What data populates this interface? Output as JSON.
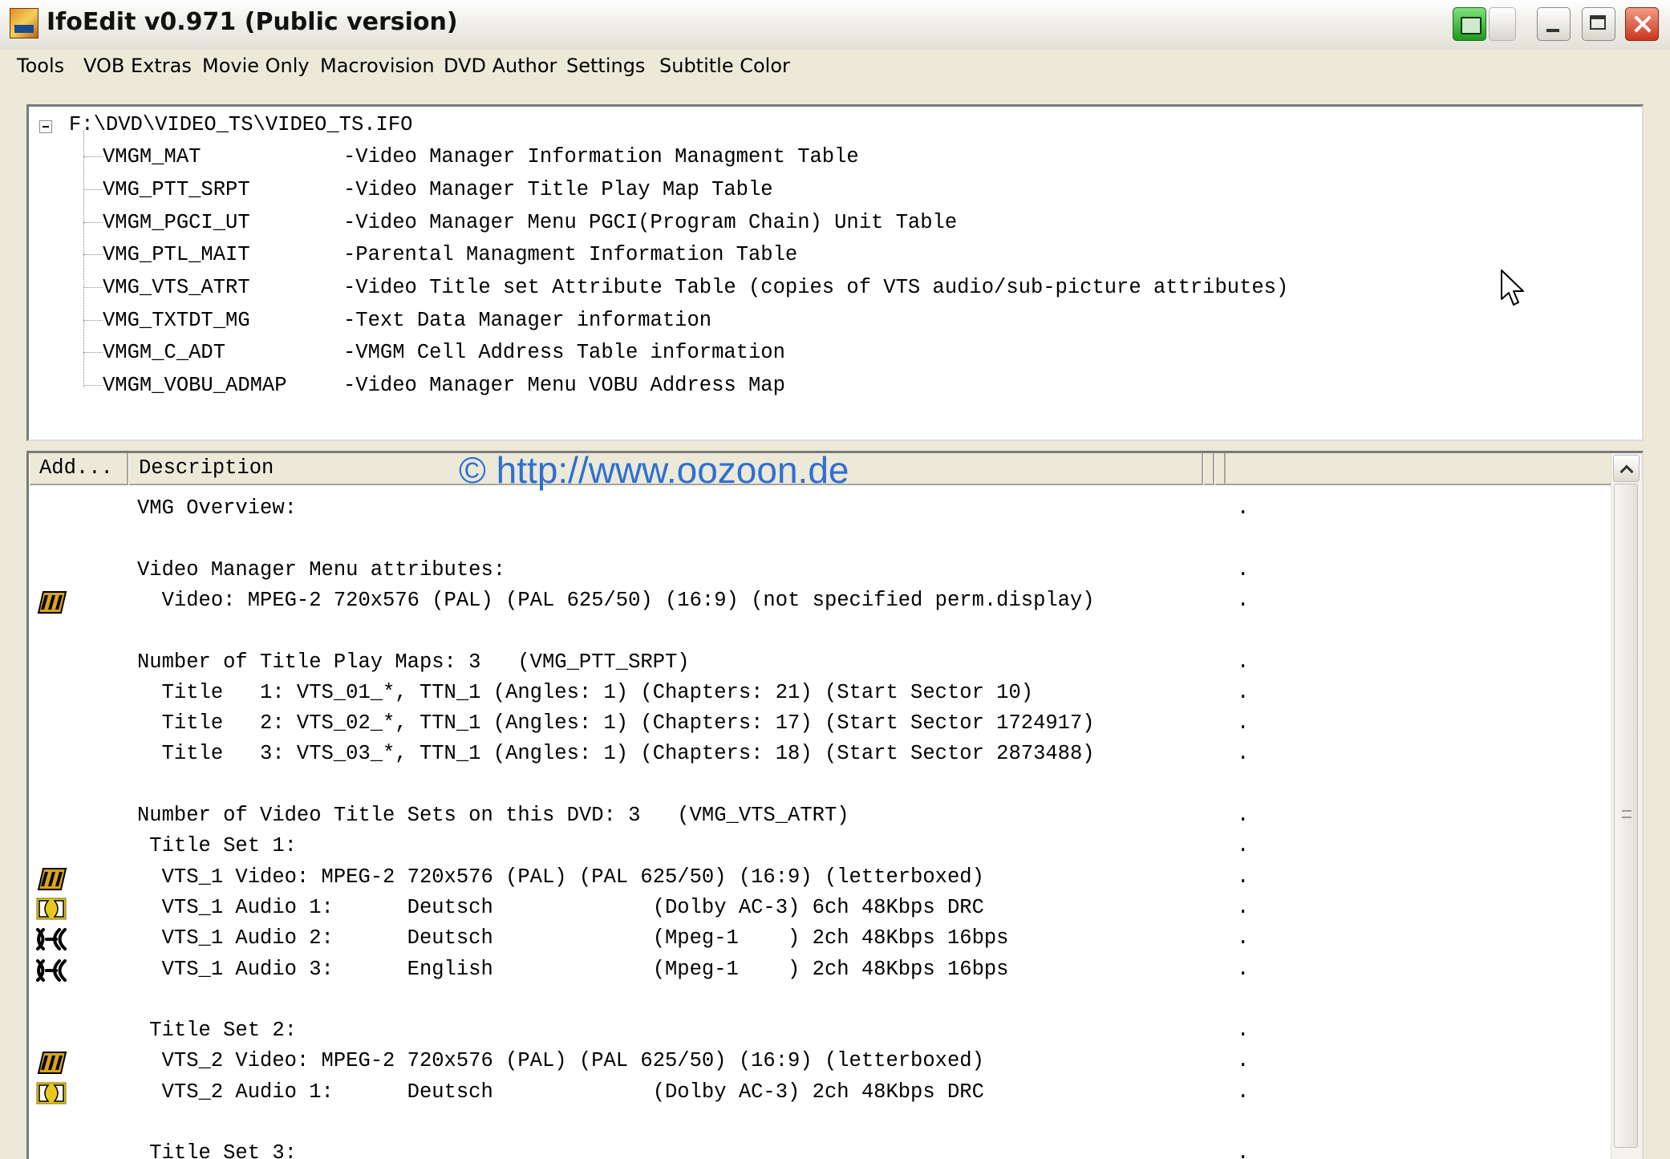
{
  "window": {
    "title": "IfoEdit v0.971 (Public version)"
  },
  "menu": [
    "Tools",
    "VOB Extras",
    "Movie Only",
    "Macrovision",
    "DVD Author",
    "Settings",
    "Subtitle Color"
  ],
  "tree": {
    "root": "F:\\DVD\\VIDEO_TS\\VIDEO_TS.IFO",
    "items": [
      {
        "name": "VMGM_MAT",
        "desc": "-Video Manager Information Managment Table"
      },
      {
        "name": "VMG_PTT_SRPT",
        "desc": "-Video Manager Title Play Map Table"
      },
      {
        "name": "VMGM_PGCI_UT",
        "desc": "-Video Manager Menu PGCI(Program Chain) Unit Table"
      },
      {
        "name": "VMG_PTL_MAIT",
        "desc": "-Parental Managment Information Table"
      },
      {
        "name": "VMG_VTS_ATRT",
        "desc": "-Video Title set Attribute Table (copies of VTS audio/sub-picture attributes)"
      },
      {
        "name": "VMG_TXTDT_MG",
        "desc": "-Text Data Manager information"
      },
      {
        "name": "VMGM_C_ADT",
        "desc": "-VMGM Cell Address Table information"
      },
      {
        "name": "VMGM_VOBU_ADMAP",
        "desc": "-Video Manager Menu VOBU Address Map"
      }
    ]
  },
  "list": {
    "columns": [
      "Add...",
      "Description"
    ],
    "watermark": "© http://www.oozoon.de",
    "rows": [
      {
        "icon": "",
        "text": "VMG Overview:",
        "dot": "."
      },
      {
        "icon": "",
        "text": "",
        "dot": ""
      },
      {
        "icon": "",
        "text": "Video Manager Menu attributes:",
        "dot": "."
      },
      {
        "icon": "video-icon",
        "text": "  Video: MPEG-2 720x576 (PAL) (PAL 625/50) (16:9) (not specified perm.display)",
        "dot": "."
      },
      {
        "icon": "",
        "text": "",
        "dot": ""
      },
      {
        "icon": "",
        "text": "Number of Title Play Maps: 3   (VMG_PTT_SRPT)",
        "dot": "."
      },
      {
        "icon": "",
        "text": "  Title   1: VTS_01_*, TTN_1 (Angles: 1) (Chapters: 21) (Start Sector 10)",
        "dot": "."
      },
      {
        "icon": "",
        "text": "  Title   2: VTS_02_*, TTN_1 (Angles: 1) (Chapters: 17) (Start Sector 1724917)",
        "dot": "."
      },
      {
        "icon": "",
        "text": "  Title   3: VTS_03_*, TTN_1 (Angles: 1) (Chapters: 18) (Start Sector 2873488)",
        "dot": "."
      },
      {
        "icon": "",
        "text": "",
        "dot": ""
      },
      {
        "icon": "",
        "text": "Number of Video Title Sets on this DVD: 3   (VMG_VTS_ATRT)",
        "dot": "."
      },
      {
        "icon": "",
        "text": " Title Set 1:",
        "dot": "."
      },
      {
        "icon": "video-icon",
        "text": "  VTS_1 Video: MPEG-2 720x576 (PAL) (PAL 625/50) (16:9) (letterboxed)",
        "dot": "."
      },
      {
        "icon": "dolby-icon",
        "text": "  VTS_1 Audio 1:      Deutsch             (Dolby AC-3) 6ch 48Kbps DRC",
        "dot": "."
      },
      {
        "icon": "mpeg-audio-icon",
        "text": "  VTS_1 Audio 2:      Deutsch             (Mpeg-1    ) 2ch 48Kbps 16bps",
        "dot": "."
      },
      {
        "icon": "mpeg-audio-icon",
        "text": "  VTS_1 Audio 3:      English             (Mpeg-1    ) 2ch 48Kbps 16bps",
        "dot": "."
      },
      {
        "icon": "",
        "text": "",
        "dot": ""
      },
      {
        "icon": "",
        "text": " Title Set 2:",
        "dot": "."
      },
      {
        "icon": "video-icon",
        "text": "  VTS_2 Video: MPEG-2 720x576 (PAL) (PAL 625/50) (16:9) (letterboxed)",
        "dot": "."
      },
      {
        "icon": "dolby-icon",
        "text": "  VTS_2 Audio 1:      Deutsch             (Dolby AC-3) 2ch 48Kbps DRC",
        "dot": "."
      },
      {
        "icon": "",
        "text": "",
        "dot": ""
      },
      {
        "icon": "",
        "text": " Title Set 3:",
        "dot": "."
      }
    ]
  },
  "colors": {
    "titlebar": "#ece9d8",
    "watermark": "#2e6fd3",
    "close": "#c8361d",
    "tray": "#1f9a1f"
  }
}
